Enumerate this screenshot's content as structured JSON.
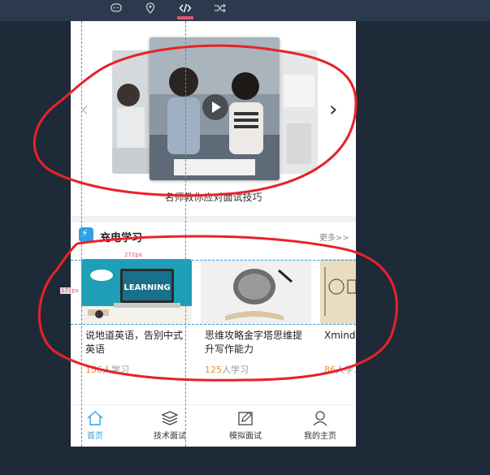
{
  "toolbar": {
    "tools": [
      {
        "icon": "message-icon",
        "active": false
      },
      {
        "icon": "location-pin-icon",
        "active": false
      },
      {
        "icon": "code-icon",
        "active": true
      },
      {
        "icon": "shuffle-icon",
        "active": false
      }
    ],
    "accent": "#e0526f"
  },
  "carousel": {
    "caption": "名师教你应对面试技巧",
    "prev": "‹",
    "next": "›"
  },
  "section": {
    "title": "充电学习",
    "more": "更多>>"
  },
  "courses": [
    {
      "title": "说地道英语，告别中式英语",
      "count": "156",
      "suffix": "人学习",
      "thumb_text": "LEARNING"
    },
    {
      "title": "思维攻略金字塔思维提升写作能力",
      "count": "125",
      "suffix": "人学习"
    },
    {
      "title": "Xmind零基础",
      "count": "86",
      "suffix": "人学习"
    }
  ],
  "tabbar": [
    {
      "label": "首页",
      "icon": "home-icon",
      "active": true
    },
    {
      "label": "技术面试",
      "icon": "layers-icon",
      "active": false
    },
    {
      "label": "模拟面试",
      "icon": "edit-icon",
      "active": false
    },
    {
      "label": "我的主页",
      "icon": "user-icon",
      "active": false
    }
  ],
  "overlay": {
    "width_label": "272px",
    "height_label": "171px"
  },
  "colors": {
    "brand": "#2fa0e6",
    "count": "#f08c2a",
    "annotation": "#e8222a"
  }
}
